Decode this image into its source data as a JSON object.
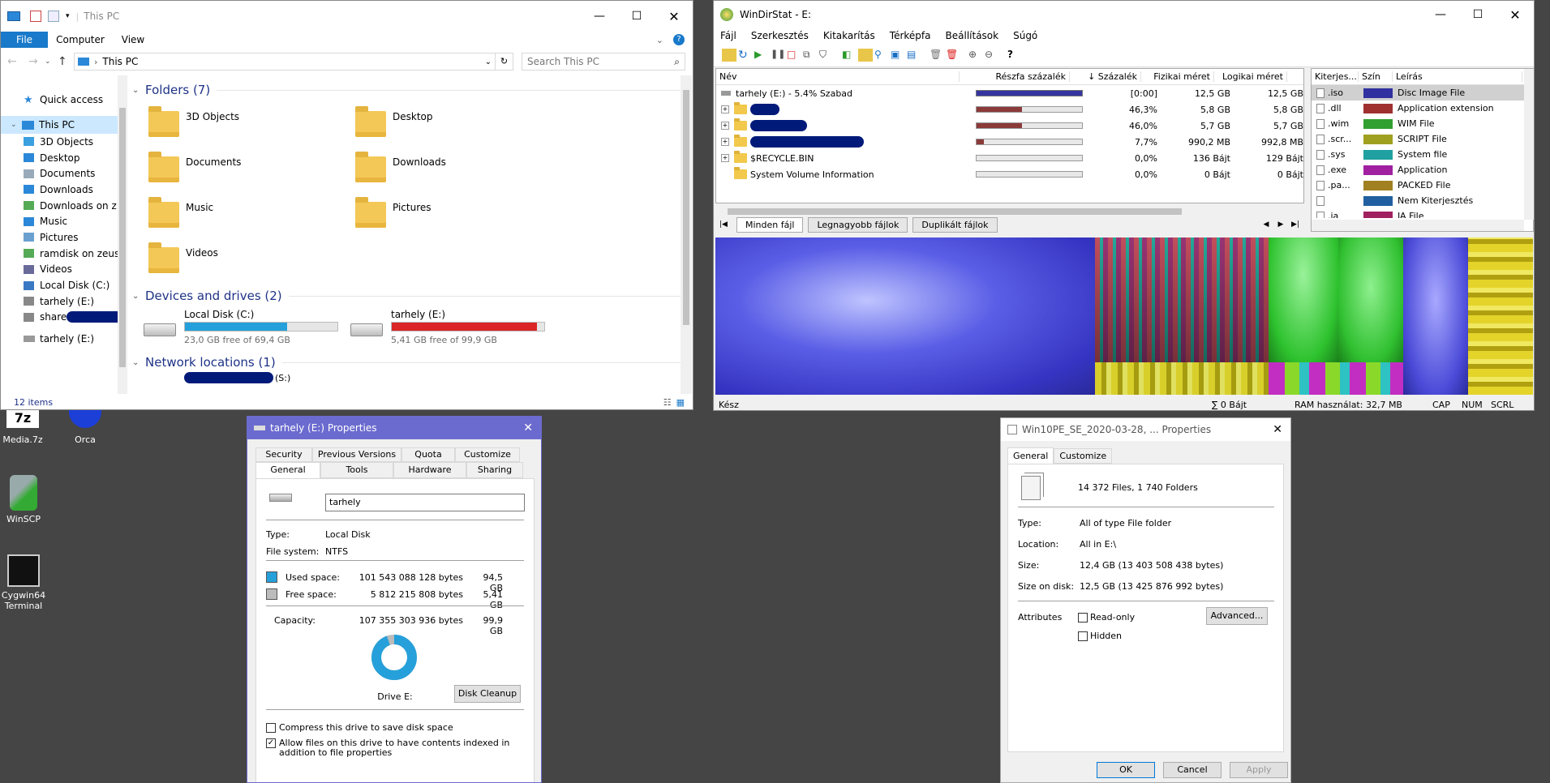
{
  "explorer": {
    "title": "This PC",
    "ribbon_tabs": [
      "File",
      "Computer",
      "View"
    ],
    "address": "This PC",
    "search_placeholder": "Search This PC",
    "nav": {
      "quick_access": "Quick access",
      "this_pc": "This PC",
      "items": [
        "3D Objects",
        "Desktop",
        "Documents",
        "Downloads",
        "Downloads on z",
        "Music",
        "Pictures",
        "ramdisk on zeus",
        "Videos",
        "Local Disk (C:)",
        "tarhely (E:)",
        "share"
      ],
      "network_drive": "tarhely (E:)"
    },
    "folders_header": "Folders (7)",
    "folders": [
      "3D Objects",
      "Desktop",
      "Documents",
      "Downloads",
      "Music",
      "Pictures",
      "Videos"
    ],
    "devices_header": "Devices and drives (2)",
    "drives": [
      {
        "name": "Local Disk (C:)",
        "free": "23,0 GB free of 69,4 GB",
        "used_fraction": 0.67,
        "color": "#26a0da"
      },
      {
        "name": "tarhely (E:)",
        "free": "5,41 GB free of 99,9 GB",
        "used_fraction": 0.95,
        "color": "#da2626"
      }
    ],
    "network_header": "Network locations (1)",
    "network_item_suffix": "(S:)",
    "status": "12 items"
  },
  "windirstat": {
    "title": "WinDirStat - E:",
    "menu": [
      "Fájl",
      "Szerkesztés",
      "Kitakarítás",
      "Térképfa",
      "Beállítások",
      "Súgó"
    ],
    "columns": [
      "Név",
      "Részfa százalék",
      "↓ Százalék",
      "Fizikai méret",
      "Logikai méret"
    ],
    "root": {
      "name": "tarhely (E:) - 5.4% Szabad",
      "percent": "[0:00]",
      "physical": "12,5 GB",
      "logical": "12,5 GB"
    },
    "rows": [
      {
        "name": "",
        "bar": 0.433,
        "percent": "46,3%",
        "physical": "5,8 GB",
        "logical": "5,8 GB"
      },
      {
        "name": "",
        "bar": 0.43,
        "percent": "46,0%",
        "physical": "5,7 GB",
        "logical": "5,7 GB"
      },
      {
        "name": "",
        "bar": 0.072,
        "percent": "7,7%",
        "physical": "990,2 MB",
        "logical": "992,8 MB"
      },
      {
        "name": "$RECYCLE.BIN",
        "bar": 0.0,
        "percent": "0,0%",
        "physical": "136 Bájt",
        "logical": "129 Bájt"
      },
      {
        "name": "System Volume Information",
        "bar": 0.0,
        "percent": "0,0%",
        "physical": "0 Bájt",
        "logical": "0 Bájt"
      }
    ],
    "tabs": [
      "Minden fájl",
      "Legnagyobb fájlok",
      "Duplikált fájlok"
    ],
    "ext_columns": [
      "Kiterjes...",
      "Szín",
      "Leírás"
    ],
    "extensions": [
      {
        "ext": ".iso",
        "color": "#3030a0",
        "desc": "Disc Image File"
      },
      {
        "ext": ".dll",
        "color": "#a03030",
        "desc": "Application extension"
      },
      {
        "ext": ".wim",
        "color": "#30a030",
        "desc": "WIM File"
      },
      {
        "ext": ".scr...",
        "color": "#a0a020",
        "desc": "SCRIPT File"
      },
      {
        "ext": ".sys",
        "color": "#20a0a0",
        "desc": "System file"
      },
      {
        "ext": ".exe",
        "color": "#a020a0",
        "desc": "Application"
      },
      {
        "ext": ".pa...",
        "color": "#a08020",
        "desc": "PACKED File"
      },
      {
        "ext": "",
        "color": "#2060a0",
        "desc": "Nem Kiterjesztés"
      },
      {
        "ext": ".ja",
        "color": "#a02060",
        "desc": "JA File"
      }
    ],
    "status_left": "Kész",
    "status_sum": "∑ 0 Bájt",
    "status_ram": "RAM használat: 32,7 MB",
    "status_keys": [
      "CAP",
      "NUM",
      "SCRL"
    ]
  },
  "desktop_icons": [
    {
      "label": "Media.7z"
    },
    {
      "label": "Orca"
    },
    {
      "label": "WinSCP"
    },
    {
      "label": "Cygwin64 Terminal"
    }
  ],
  "drive_props": {
    "title": "tarhely (E:) Properties",
    "tabs_top": [
      "Security",
      "Previous Versions",
      "Quota",
      "Customize"
    ],
    "tabs_bottom": [
      "General",
      "Tools",
      "Hardware",
      "Sharing"
    ],
    "name_value": "tarhely",
    "type_label": "Type:",
    "type_value": "Local Disk",
    "fs_label": "File system:",
    "fs_value": "NTFS",
    "used_label": "Used space:",
    "used_bytes": "101 543 088 128 bytes",
    "used_gb": "94,5 GB",
    "free_label": "Free space:",
    "free_bytes": "5 812 215 808 bytes",
    "free_gb": "5,41 GB",
    "cap_label": "Capacity:",
    "cap_bytes": "107 355 303 936 bytes",
    "cap_gb": "99,9 GB",
    "used_fraction": 0.946,
    "drive_label": "Drive E:",
    "cleanup": "Disk Cleanup",
    "compress": "Compress this drive to save disk space",
    "index": "Allow files on this drive to have contents indexed in addition to file properties",
    "used_color": "#26a0da",
    "free_color": "#bcbcbc"
  },
  "folder_props": {
    "title": "Win10PE_SE_2020-03-28, ... Properties",
    "tabs": [
      "General",
      "Customize"
    ],
    "summary": "14 372 Files, 1 740 Folders",
    "type_label": "Type:",
    "type_value": "All of type File folder",
    "location_label": "Location:",
    "location_value": "All in E:\\",
    "size_label": "Size:",
    "size_value": "12,4 GB (13 403 508 438 bytes)",
    "disk_label": "Size on disk:",
    "disk_value": "12,5 GB (13 425 876 992 bytes)",
    "attr_label": "Attributes",
    "readonly": "Read-only",
    "hidden": "Hidden",
    "advanced": "Advanced...",
    "ok": "OK",
    "cancel": "Cancel",
    "apply": "Apply"
  }
}
